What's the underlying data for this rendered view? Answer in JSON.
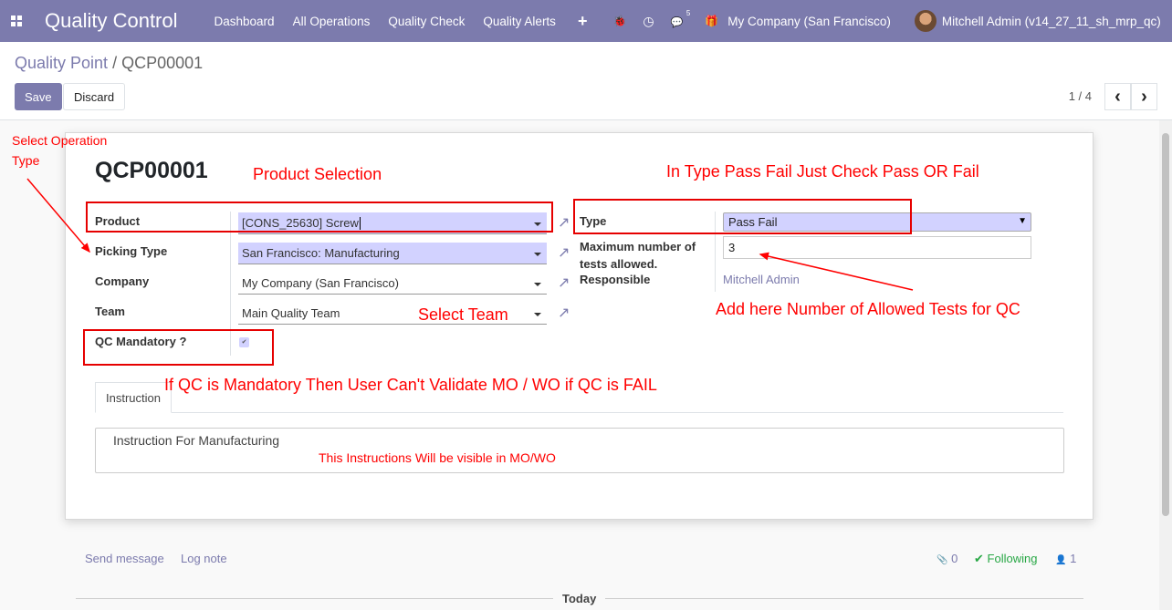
{
  "navbar": {
    "app_title": "Quality Control",
    "menu": [
      "Dashboard",
      "All Operations",
      "Quality Check",
      "Quality Alerts"
    ],
    "plus_icon": "+",
    "bug_icon": "🐞",
    "clock_icon": "◷",
    "chat_icon": "💬",
    "chat_count": "5",
    "gift_icon": "🎁",
    "company": "My Company (San Francisco)",
    "user": "Mitchell Admin (v14_27_11_sh_mrp_qc)"
  },
  "breadcrumb": {
    "parent": "Quality Point",
    "separator": "/",
    "current": "QCP00001"
  },
  "buttons": {
    "save": "Save",
    "discard": "Discard"
  },
  "pager": {
    "value": "1 / 4",
    "prev": "‹",
    "next": "›"
  },
  "record": {
    "title": "QCP00001",
    "fields": {
      "product": {
        "label": "Product",
        "value": "[CONS_25630] Screw"
      },
      "picking_type": {
        "label": "Picking Type",
        "value": "San Francisco: Manufacturing"
      },
      "company": {
        "label": "Company",
        "value": "My Company (San Francisco)"
      },
      "team": {
        "label": "Team",
        "value": "Main Quality Team"
      },
      "qc_mandatory": {
        "label": "QC Mandatory ?",
        "checked": true,
        "check_glyph": "✔"
      },
      "type": {
        "label": "Type",
        "value": "Pass Fail"
      },
      "max_tests": {
        "label_line1": "Maximum number of",
        "label_line2": "tests allowed.",
        "value": "3"
      },
      "responsible": {
        "label": "Responsible",
        "value": "Mitchell Admin"
      }
    },
    "ext_link_glyph": "↗",
    "select_glyph": "▼"
  },
  "notebook": {
    "tab": "Instruction",
    "instruction": "Instruction For Manufacturing"
  },
  "annotations": {
    "select_operation_line1": "Select Operation",
    "select_operation_line2": "Type",
    "product_selection": "Product Selection",
    "type_note": "In Type Pass Fail Just Check Pass OR Fail",
    "select_team": "Select Team",
    "allowed_tests": "Add here Number of Allowed Tests for QC",
    "mandatory_note": "If QC is Mandatory Then User Can't Validate MO / WO if QC is FAIL",
    "instruction_note": "This Instructions Will be visible in MO/WO",
    "color": "#ff0000"
  },
  "chatter": {
    "send_message": "Send message",
    "log_note": "Log note",
    "attachments_icon": "📎",
    "attachments_count": "0",
    "following_icon": "✔",
    "following": "Following",
    "followers_icon": "👤",
    "followers_count": "1",
    "today": "Today"
  },
  "colors": {
    "brand": "#7c7bad",
    "required_field": "#d2d2ff",
    "following": "#28a745"
  }
}
